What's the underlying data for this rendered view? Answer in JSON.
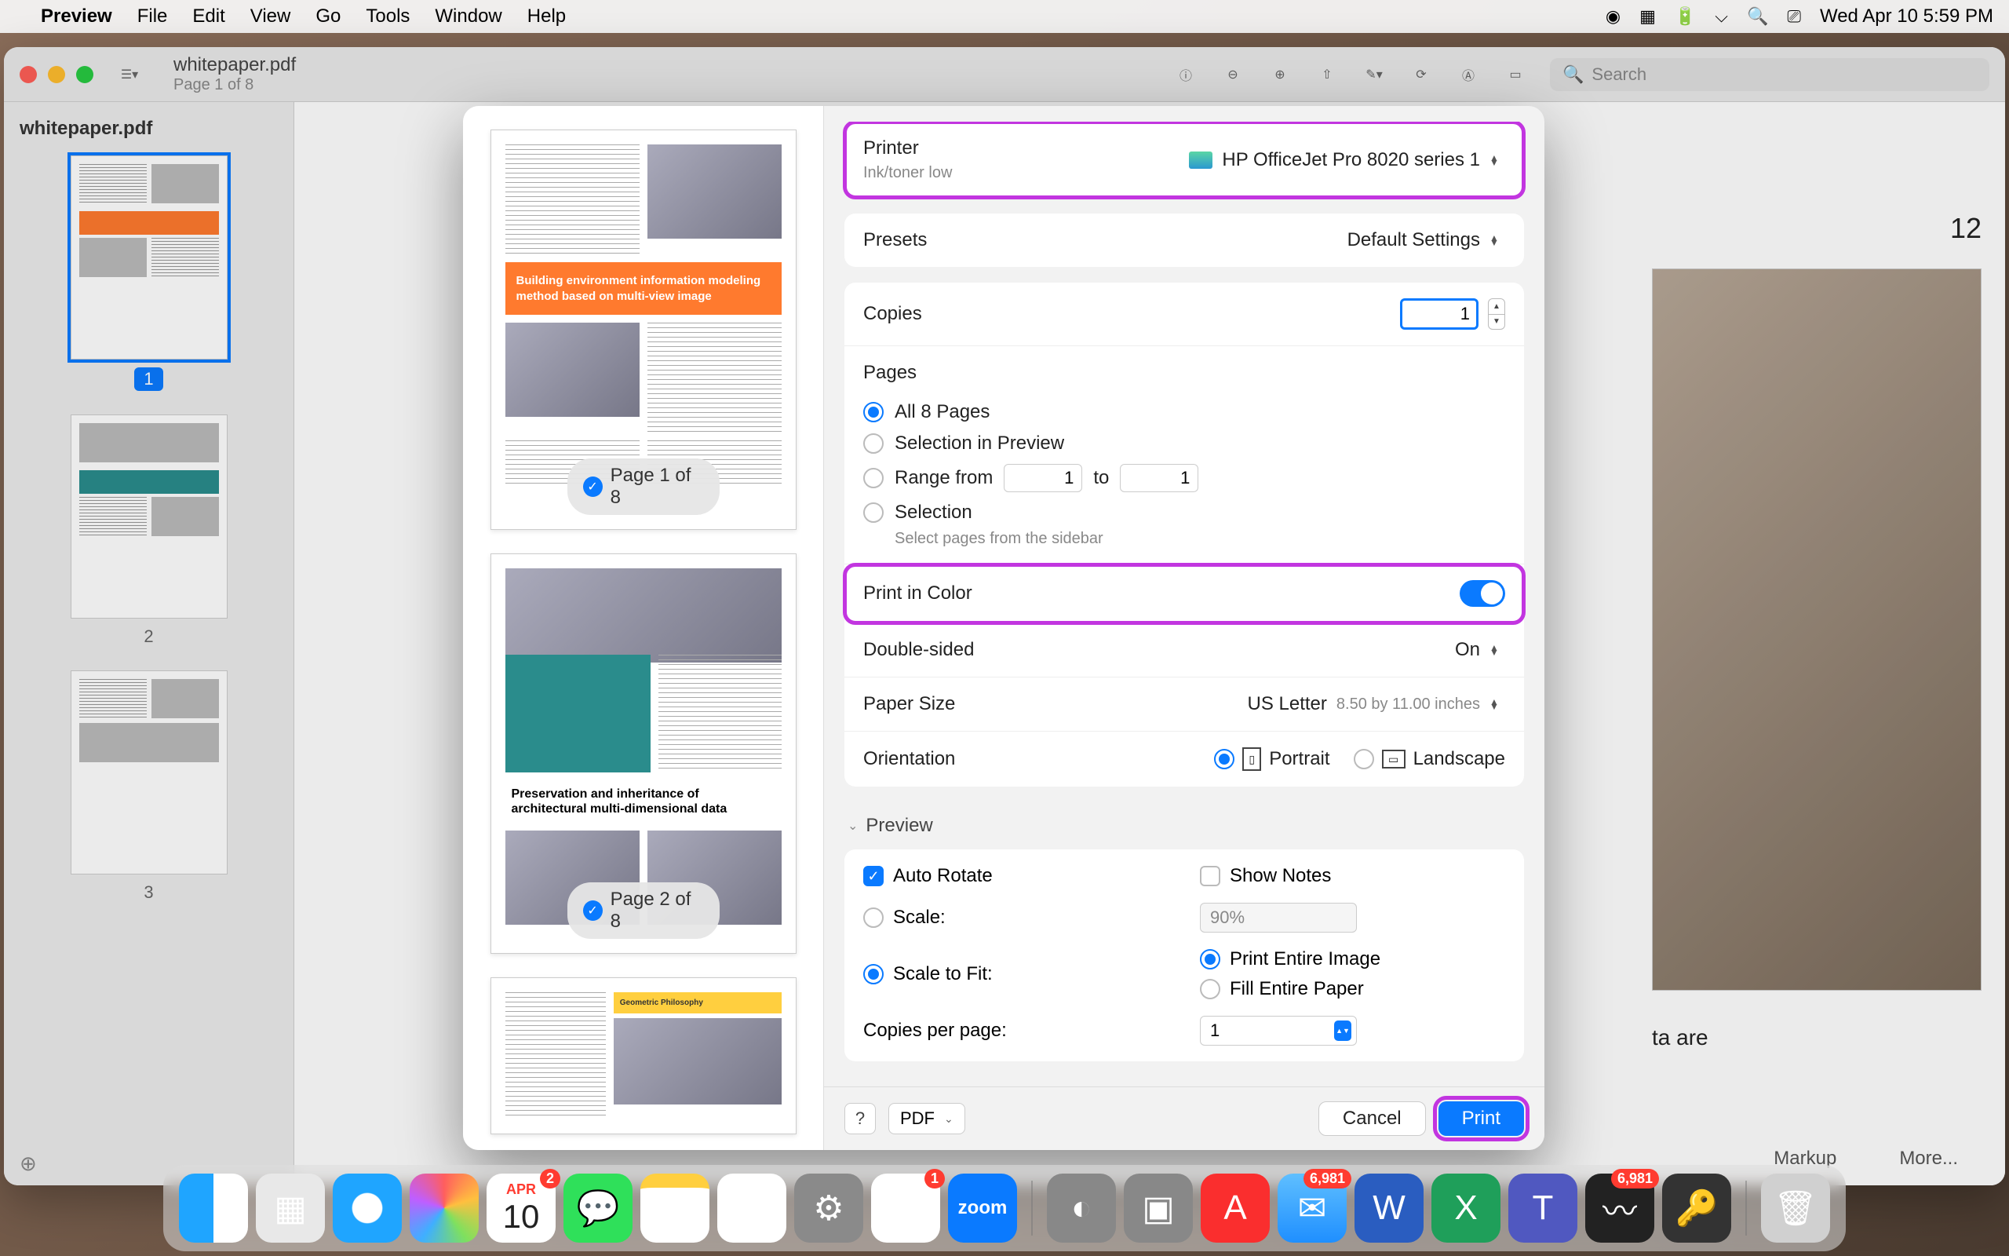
{
  "menubar": {
    "app": "Preview",
    "items": [
      "File",
      "Edit",
      "View",
      "Go",
      "Tools",
      "Window",
      "Help"
    ],
    "clock": "Wed Apr 10  5:59 PM"
  },
  "window": {
    "filename": "whitepaper.pdf",
    "page_info": "Page 1 of 8",
    "search_placeholder": "Search"
  },
  "sidebar": {
    "title": "whitepaper.pdf",
    "thumbs": [
      {
        "num": "1",
        "selected": true
      },
      {
        "num": "2",
        "selected": false
      },
      {
        "num": "3",
        "selected": false
      }
    ]
  },
  "behind": {
    "page_num": "12",
    "text_line": "ta are",
    "link_markup": "Markup",
    "link_more": "More..."
  },
  "dialog": {
    "page_badges": [
      "Page 1 of 8",
      "Page 2 of 8"
    ],
    "thumb1": {
      "banner": "Building environment information modeling method based on multi-view image"
    },
    "thumb2": {
      "title": "Preservation and inheritance of architectural multi-dimensional data"
    },
    "thumb3": {
      "title": "Geometric Philosophy"
    },
    "printer_label": "Printer",
    "printer_value": "HP OfficeJet Pro 8020 series 1",
    "printer_status": "Ink/toner low",
    "presets_label": "Presets",
    "presets_value": "Default Settings",
    "copies_label": "Copies",
    "copies_value": "1",
    "pages_label": "Pages",
    "pages_all": "All 8 Pages",
    "pages_selection": "Selection in Preview",
    "pages_range": "Range from",
    "pages_range_from": "1",
    "pages_range_to_label": "to",
    "pages_range_to": "1",
    "pages_select": "Selection",
    "pages_select_hint": "Select pages from the sidebar",
    "color_label": "Print in Color",
    "duplex_label": "Double-sided",
    "duplex_value": "On",
    "paper_label": "Paper Size",
    "paper_value": "US Letter",
    "paper_dims": "8.50 by 11.00 inches",
    "orient_label": "Orientation",
    "orient_portrait": "Portrait",
    "orient_landscape": "Landscape",
    "preview_section": "Preview",
    "auto_rotate": "Auto Rotate",
    "show_notes": "Show Notes",
    "scale_label": "Scale:",
    "scale_value": "90%",
    "scale_fit": "Scale to Fit:",
    "fit_entire_image": "Print Entire Image",
    "fit_entire_paper": "Fill Entire Paper",
    "copies_per_page": "Copies per page:",
    "copies_per_page_value": "1",
    "help": "?",
    "pdf_btn": "PDF",
    "cancel": "Cancel",
    "print": "Print"
  },
  "dock": {
    "cal_month": "APR",
    "cal_day": "10",
    "zoom": "zoom",
    "badges": {
      "cal": "2",
      "chrome": "1",
      "mail": "6,981",
      "wez": "6,981"
    }
  }
}
